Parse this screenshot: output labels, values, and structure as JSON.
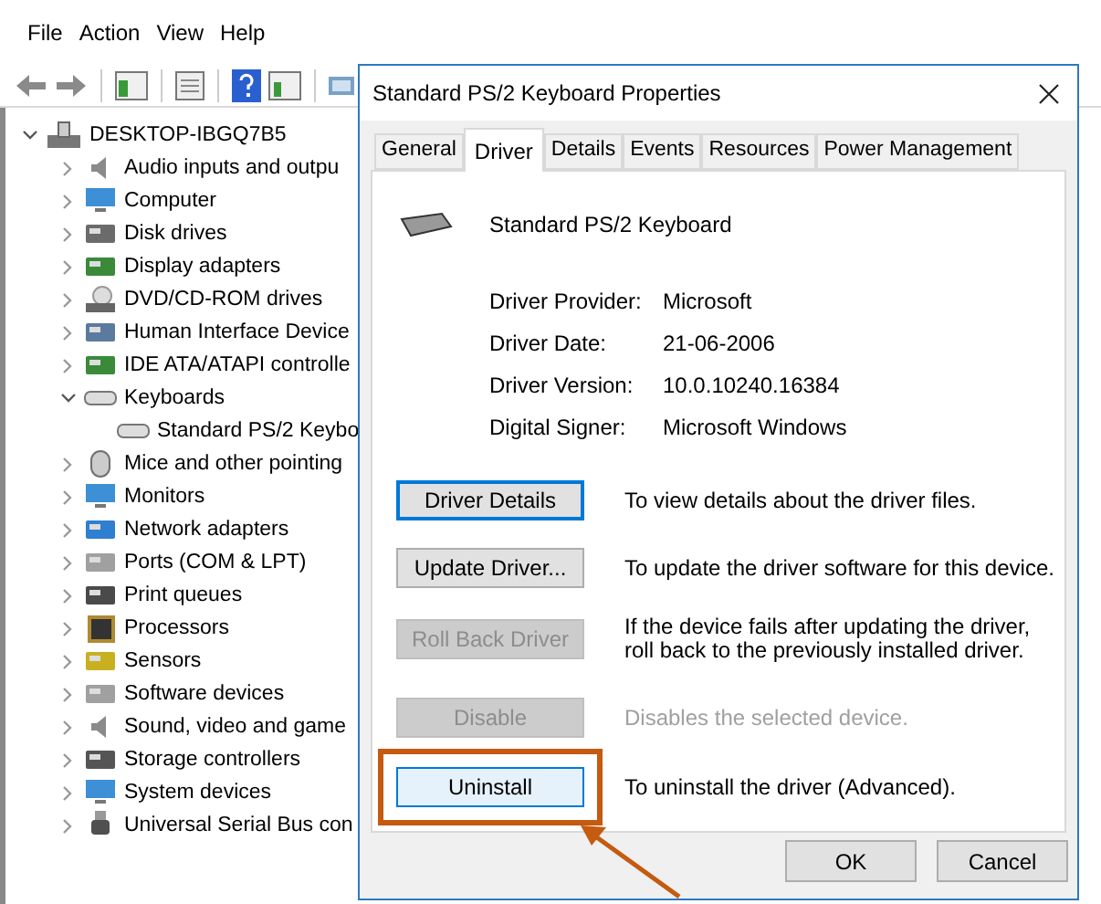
{
  "menu": [
    "File",
    "Action",
    "View",
    "Help"
  ],
  "tree": {
    "label": "DESKTOP-IBGQ7B5",
    "expanded": true,
    "children": [
      {
        "label": "Audio inputs and outpu",
        "kind": "speaker",
        "expanded": false
      },
      {
        "label": "Computer",
        "kind": "monitor",
        "expanded": false
      },
      {
        "label": "Disk drives",
        "kind": "disk",
        "expanded": false
      },
      {
        "label": "Display adapters",
        "kind": "card",
        "expanded": false
      },
      {
        "label": "DVD/CD-ROM drives",
        "kind": "disc",
        "expanded": false
      },
      {
        "label": "Human Interface Device",
        "kind": "hid",
        "expanded": false
      },
      {
        "label": "IDE ATA/ATAPI controlle",
        "kind": "card",
        "expanded": false
      },
      {
        "label": "Keyboards",
        "kind": "keyboard",
        "expanded": true,
        "children": [
          {
            "label": "Standard PS/2 Keybo",
            "kind": "keyboard"
          }
        ]
      },
      {
        "label": "Mice and other pointing",
        "kind": "mouse",
        "expanded": false
      },
      {
        "label": "Monitors",
        "kind": "monitor",
        "expanded": false
      },
      {
        "label": "Network adapters",
        "kind": "network",
        "expanded": false
      },
      {
        "label": "Ports (COM & LPT)",
        "kind": "port",
        "expanded": false
      },
      {
        "label": "Print queues",
        "kind": "printer",
        "expanded": false
      },
      {
        "label": "Processors",
        "kind": "chip",
        "expanded": false
      },
      {
        "label": "Sensors",
        "kind": "sensor",
        "expanded": false
      },
      {
        "label": "Software devices",
        "kind": "port",
        "expanded": false
      },
      {
        "label": "Sound, video and game",
        "kind": "speaker",
        "expanded": false
      },
      {
        "label": "Storage controllers",
        "kind": "storage",
        "expanded": false
      },
      {
        "label": "System devices",
        "kind": "monitor",
        "expanded": false
      },
      {
        "label": "Universal Serial Bus con",
        "kind": "usb",
        "expanded": false
      }
    ]
  },
  "dialog": {
    "title": "Standard PS/2 Keyboard Properties",
    "tabs": [
      {
        "label": "General",
        "selected": false
      },
      {
        "label": "Driver",
        "selected": true
      },
      {
        "label": "Details",
        "selected": false
      },
      {
        "label": "Events",
        "selected": false
      },
      {
        "label": "Resources",
        "selected": false
      },
      {
        "label": "Power Management",
        "selected": false
      }
    ],
    "device_name": "Standard PS/2 Keyboard",
    "info": [
      {
        "label": "Driver Provider:",
        "value": "Microsoft"
      },
      {
        "label": "Driver Date:",
        "value": "21-06-2006"
      },
      {
        "label": "Driver Version:",
        "value": "10.0.10240.16384"
      },
      {
        "label": "Digital Signer:",
        "value": "Microsoft Windows"
      }
    ],
    "actions": [
      {
        "label": "Driver Details",
        "description": "To view details about the driver files.",
        "disabled": false,
        "focused": true,
        "highlighted": false,
        "description_greyed": false
      },
      {
        "label": "Update Driver...",
        "description": "To update the driver software for this device.",
        "disabled": false,
        "focused": false,
        "highlighted": false,
        "description_greyed": false
      },
      {
        "label": "Roll Back Driver",
        "description": "If the device fails after updating the driver, roll back to the previously installed driver.",
        "disabled": true,
        "focused": false,
        "highlighted": false,
        "description_greyed": false
      },
      {
        "label": "Disable",
        "description": "Disables the selected device.",
        "disabled": true,
        "focused": false,
        "highlighted": false,
        "description_greyed": true
      },
      {
        "label": "Uninstall",
        "description": "To uninstall the driver (Advanced).",
        "disabled": false,
        "focused": false,
        "highlighted": true,
        "description_greyed": false
      }
    ],
    "buttons": [
      "OK",
      "Cancel"
    ]
  }
}
